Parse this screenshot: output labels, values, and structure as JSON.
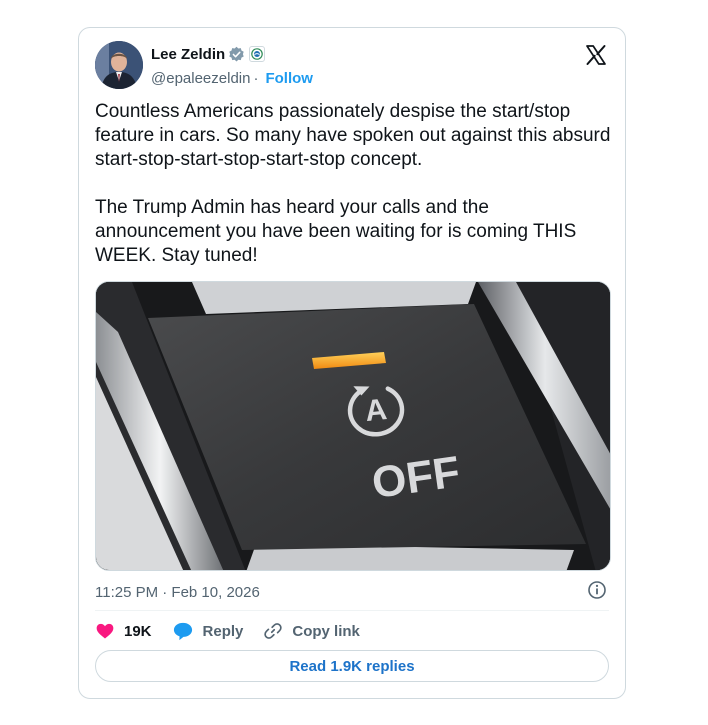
{
  "author": {
    "name": "Lee Zeldin",
    "handle": "@epaleezeldin",
    "separator": "·",
    "follow_label": "Follow"
  },
  "icons": {
    "verified": "verified-badge-icon",
    "affiliation": "epa-affiliation-icon",
    "platform": "x-logo-icon",
    "info": "info-icon",
    "like": "heart-icon",
    "reply": "reply-bubble-icon",
    "copy": "link-icon"
  },
  "colors": {
    "accent": "#1d9bf0",
    "like": "#f91880",
    "text": "#0f1419",
    "muted": "#536471",
    "verified": "#829aab"
  },
  "post": {
    "paragraph_1": "Countless Americans passionately despise the start/stop feature in cars. So many have spoken out against this absurd start-stop-start-stop-start-stop concept.",
    "paragraph_2": "The Trump Admin has heard your calls and the announcement you have been waiting for is coming THIS WEEK. Stay tuned!",
    "timestamp": "11:25 PM · Feb 10, 2026"
  },
  "media": {
    "button_label": "OFF",
    "symbol_letter": "A"
  },
  "actions": {
    "likes_count": "19K",
    "reply_label": "Reply",
    "copy_label": "Copy link"
  },
  "footer": {
    "read_replies_label": "Read 1.9K replies"
  }
}
